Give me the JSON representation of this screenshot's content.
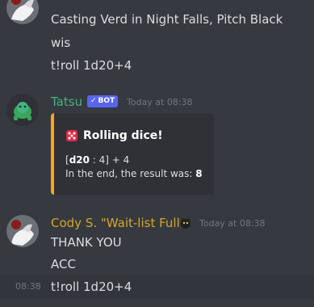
{
  "top_group": {
    "lines": [
      "Casting Verd in Night Falls, Pitch Black",
      "wis",
      "t!roll 1d20+4"
    ]
  },
  "tatsu_group": {
    "username": "Tatsu",
    "username_color": "#43b581",
    "bot_tag": "BOT",
    "timestamp": "Today at 08:38",
    "embed": {
      "accent_color": "#faa61a",
      "title_icon": "dice-icon",
      "title": "Rolling dice!",
      "roll_open": "[",
      "roll_die": "d20",
      "roll_rest": " : 4] + 4",
      "result_label": "In the end, the result was: ",
      "result_value": "8"
    }
  },
  "cody_group": {
    "username": "Cody S. \"Wait-list Full",
    "username_color": "#d4a72c",
    "badge_icon": "cat-badge-icon",
    "timestamp": "Today at 08:38",
    "lines": [
      "THANK YOU",
      "ACC"
    ]
  },
  "hover_message": {
    "timestamp": "08:38",
    "text": "t!roll 1d20+4"
  }
}
